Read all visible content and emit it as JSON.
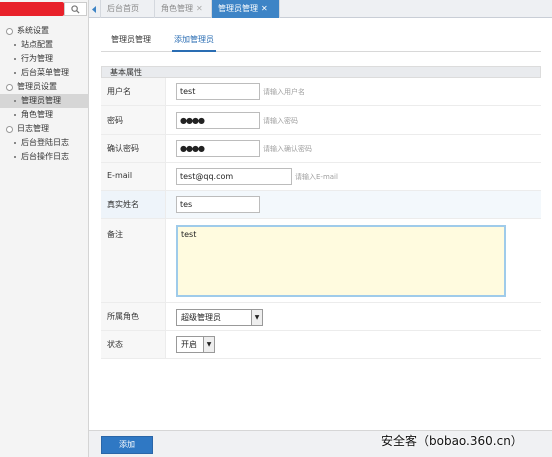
{
  "sidebar": {
    "tree": [
      {
        "type": "group",
        "label": "系统设置"
      },
      {
        "type": "item",
        "label": "站点配置"
      },
      {
        "type": "item",
        "label": "行为管理"
      },
      {
        "type": "item",
        "label": "后台菜单管理"
      },
      {
        "type": "group",
        "label": "管理员设置"
      },
      {
        "type": "item",
        "label": "管理员管理",
        "active": true
      },
      {
        "type": "item",
        "label": "角色管理"
      },
      {
        "type": "group",
        "label": "日志管理"
      },
      {
        "type": "item",
        "label": "后台登陆日志"
      },
      {
        "type": "item",
        "label": "后台操作日志"
      }
    ]
  },
  "tabs": [
    {
      "label": "后台首页",
      "closable": false
    },
    {
      "label": "角色管理",
      "closable": true
    },
    {
      "label": "管理员管理",
      "closable": true,
      "active": true
    }
  ],
  "subtabs": [
    {
      "label": "管理员管理"
    },
    {
      "label": "添加管理员",
      "active": true
    }
  ],
  "form": {
    "section_title": "基本属性",
    "username": {
      "label": "用户名",
      "value": "test",
      "hint": "请输入用户名"
    },
    "password": {
      "label": "密码",
      "value": "●●●●",
      "hint": "请输入密码"
    },
    "confirm": {
      "label": "确认密码",
      "value": "●●●●",
      "hint": "请输入确认密码"
    },
    "email": {
      "label": "E-mail",
      "value": "test@qq.com",
      "hint": "请输入E-mail"
    },
    "realname": {
      "label": "真实姓名",
      "value": "tes"
    },
    "remark": {
      "label": "备注",
      "value": "test"
    },
    "role": {
      "label": "所属角色",
      "value": "超级管理员"
    },
    "status": {
      "label": "状态",
      "value": "开启"
    }
  },
  "submit_label": "添加",
  "watermark": "安全客（bobao.360.cn）"
}
